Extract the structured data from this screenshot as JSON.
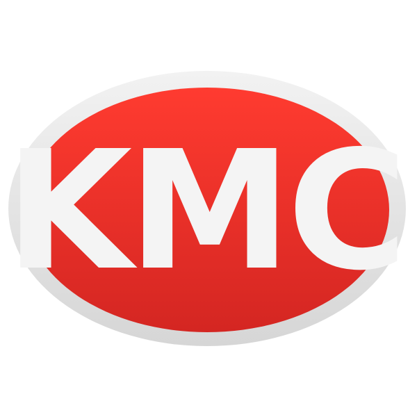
{
  "logo": {
    "text": "KMC",
    "colors": {
      "ring_light": "#f2f2f2",
      "ring_dark": "#d6d6d6",
      "oval_top": "#ff3b30",
      "oval_bottom": "#d42622",
      "text": "#f4f4f4"
    }
  }
}
